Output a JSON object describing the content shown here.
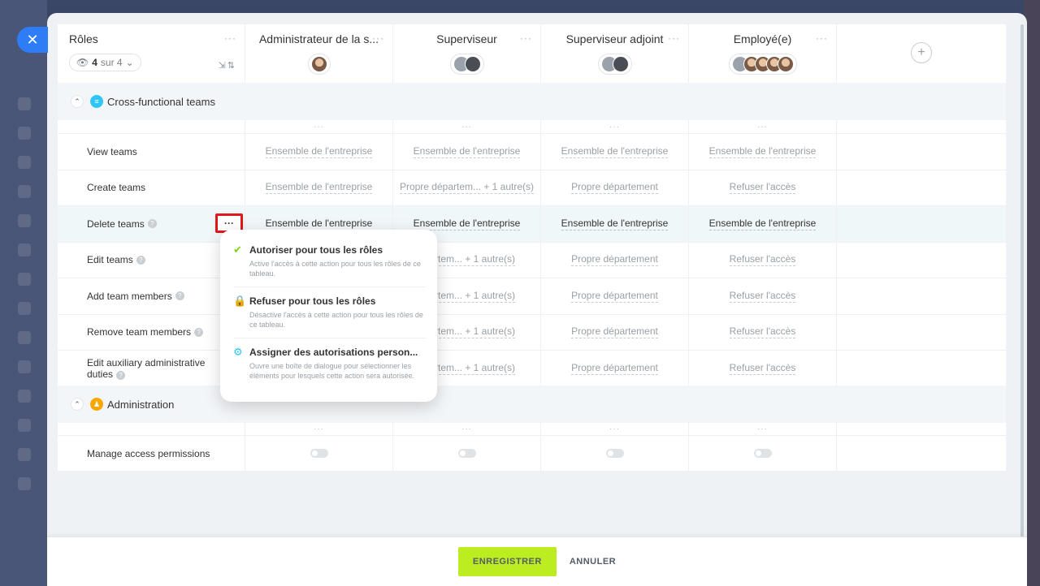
{
  "header": {
    "roles_label": "Rôles",
    "filter": {
      "count": "4",
      "of": "sur 4"
    },
    "columns": [
      {
        "title": "Administrateur de la s..."
      },
      {
        "title": "Superviseur"
      },
      {
        "title": "Superviseur adjoint"
      },
      {
        "title": "Employé(e)"
      }
    ]
  },
  "sections": [
    {
      "title": "Cross-functional teams",
      "icon": "teams-icon",
      "rows": [
        {
          "label": "View teams",
          "values": [
            "Ensemble de l'entreprise",
            "Ensemble de l'entreprise",
            "Ensemble de l'entreprise",
            "Ensemble de l'entreprise"
          ]
        },
        {
          "label": "Create teams",
          "values": [
            "Ensemble de l'entreprise",
            "Propre départem... + 1 autre(s)",
            "Propre département",
            "Refuser l'accès"
          ]
        },
        {
          "label": "Delete teams",
          "values": [
            "Ensemble de l'entreprise",
            "Ensemble de l'entreprise",
            "Ensemble de l'entreprise",
            "Ensemble de l'entreprise"
          ]
        },
        {
          "label": "Edit teams",
          "values": [
            "",
            "épartem... + 1 autre(s)",
            "Propre département",
            "Refuser l'accès"
          ]
        },
        {
          "label": "Add team members",
          "values": [
            "",
            "épartem... + 1 autre(s)",
            "Propre département",
            "Refuser l'accès"
          ]
        },
        {
          "label": "Remove team members",
          "values": [
            "",
            "épartem... + 1 autre(s)",
            "Propre département",
            "Refuser l'accès"
          ]
        },
        {
          "label_line1": "Edit auxiliary administrative",
          "label_line2": "duties",
          "values": [
            "",
            "épartem... + 1 autre(s)",
            "Propre département",
            "Refuser l'accès"
          ]
        }
      ]
    },
    {
      "title": "Administration",
      "icon": "admin-icon",
      "rows": [
        {
          "label": "Manage access permissions"
        }
      ]
    }
  ],
  "popup": {
    "items": [
      {
        "title": "Autoriser pour tous les rôles",
        "desc": "Active l'accès à cette action pour tous les rôles de ce tableau.",
        "color": "#7bd500"
      },
      {
        "title": "Refuser pour tous les rôles",
        "desc": "Désactive l'accès à cette action pour tous les rôles de ce tableau.",
        "color": "#ff5752"
      },
      {
        "title": "Assigner des autorisations person...",
        "desc": "Ouvre une boîte de dialogue pour sélectionner les éléments pour lesquels cette action sera autorisée.",
        "color": "#2fc6f6"
      }
    ]
  },
  "footer": {
    "save": "ENREGISTRER",
    "cancel": "ANNULER"
  },
  "colors": {
    "accent_green": "#bbed21",
    "close_blue": "#2f7df6",
    "highlight_red": "#e0171b"
  }
}
